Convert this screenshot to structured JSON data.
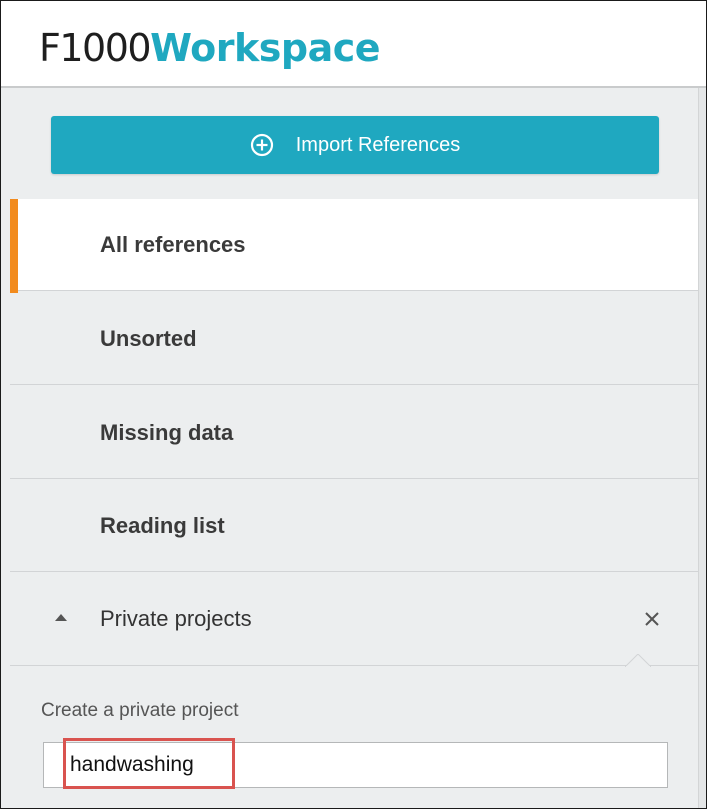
{
  "header": {
    "brand": "F1000",
    "product": "Workspace"
  },
  "sidebar": {
    "import_button": {
      "label": "Import References",
      "icon": "plus-circle-icon"
    },
    "items": [
      {
        "label": "All references",
        "active": true
      },
      {
        "label": "Unsorted",
        "active": false
      },
      {
        "label": "Missing data",
        "active": false
      },
      {
        "label": "Reading list",
        "active": false
      }
    ],
    "private_projects": {
      "label": "Private projects",
      "expanded": true,
      "close_icon": "close-icon",
      "create_label": "Create a private project",
      "input_value": "handwashing"
    }
  },
  "colors": {
    "accent": "#1fa8c0",
    "active_indicator": "#f28b1e",
    "highlight": "#d9534f",
    "sidebar_bg": "#eceeef"
  }
}
